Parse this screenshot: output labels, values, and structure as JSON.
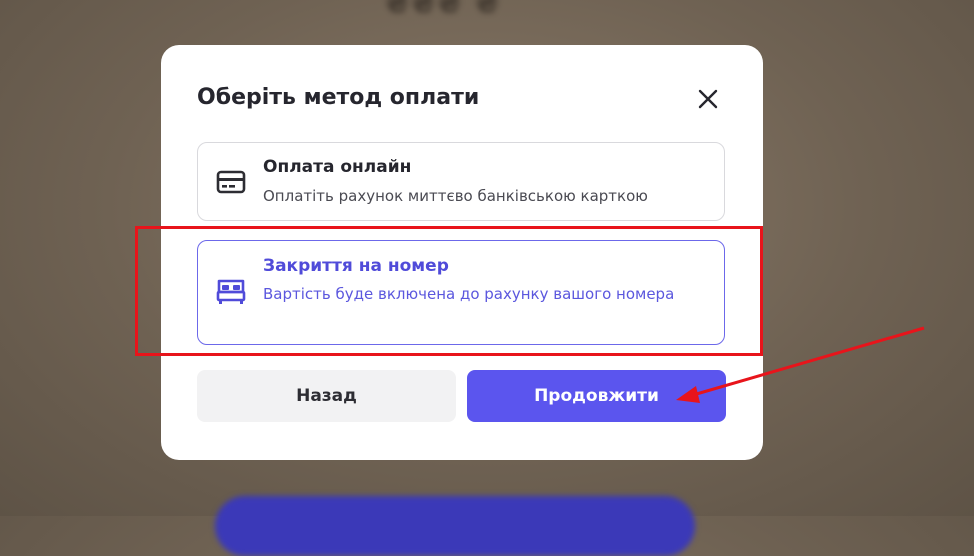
{
  "background": {
    "heading_text": "₴₴₴ ₴"
  },
  "modal": {
    "title": "Оберіть метод оплати",
    "close_icon": "close-icon",
    "options": [
      {
        "title": "Оплата онлайн",
        "description": "Оплатіть рахунок миттєво банківською карткою",
        "icon": "credit-card-icon",
        "selected": false
      },
      {
        "title": "Закриття на номер",
        "description": "Вартість буде включена до рахунку вашого номера",
        "icon": "bed-icon",
        "selected": true
      }
    ],
    "buttons": {
      "back": "Назад",
      "continue": "Продовжити"
    }
  },
  "colors": {
    "accent": "#5b55ee",
    "selected_text": "#504bd9",
    "annotation": "#e8141b"
  }
}
